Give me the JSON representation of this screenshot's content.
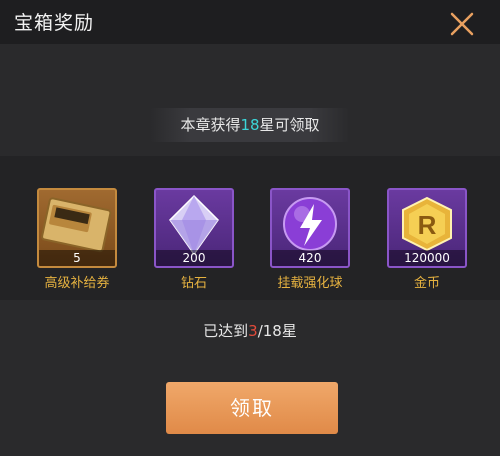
{
  "header": {
    "title": "宝箱奖励"
  },
  "requirement": {
    "prefix": "本章获得",
    "stars": "18",
    "suffix": "星可领取"
  },
  "rewards": [
    {
      "name": "高级补给券",
      "quantity": "5",
      "icon": "supply-ticket-icon"
    },
    {
      "name": "钻石",
      "quantity": "200",
      "icon": "diamond-icon"
    },
    {
      "name": "挂载强化球",
      "quantity": "420",
      "icon": "lightning-orb-icon"
    },
    {
      "name": "金币",
      "quantity": "120000",
      "icon": "gold-coin-icon"
    }
  ],
  "progress": {
    "prefix": "已达到",
    "current": "3",
    "suffix": "/18星"
  },
  "claim_button": {
    "label": "领取"
  },
  "colors": {
    "highlight": "#3cd5d8",
    "progress_current": "#e04a3a",
    "reward_name": "#e6b240",
    "button": "#e8964f"
  }
}
